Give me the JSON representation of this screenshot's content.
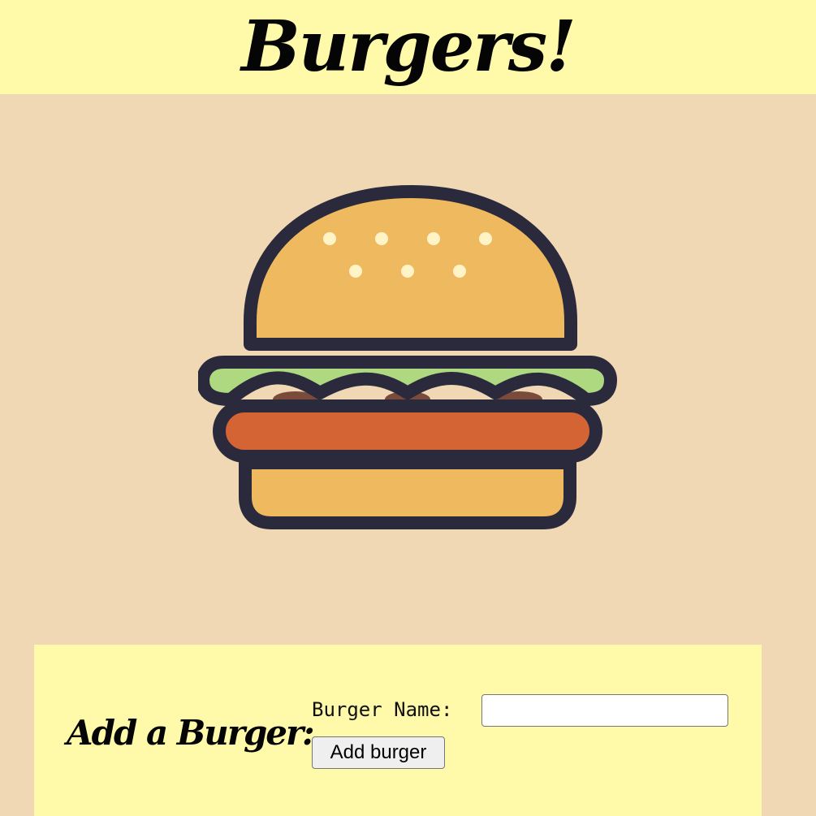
{
  "header": {
    "title": "Burgers!"
  },
  "illustration": {
    "icon": "burger-icon"
  },
  "form": {
    "heading": "Add a Burger:",
    "name_label": "Burger Name:",
    "name_value": "",
    "name_placeholder": "",
    "submit_label": "Add burger"
  },
  "colors": {
    "header_bg": "#fefaa9",
    "page_bg": "#efd8b3",
    "outline": "#2b2a3c",
    "bun": "#efb95f",
    "lettuce": "#afd980",
    "patty": "#d46434",
    "sesame": "#fff4c8"
  }
}
